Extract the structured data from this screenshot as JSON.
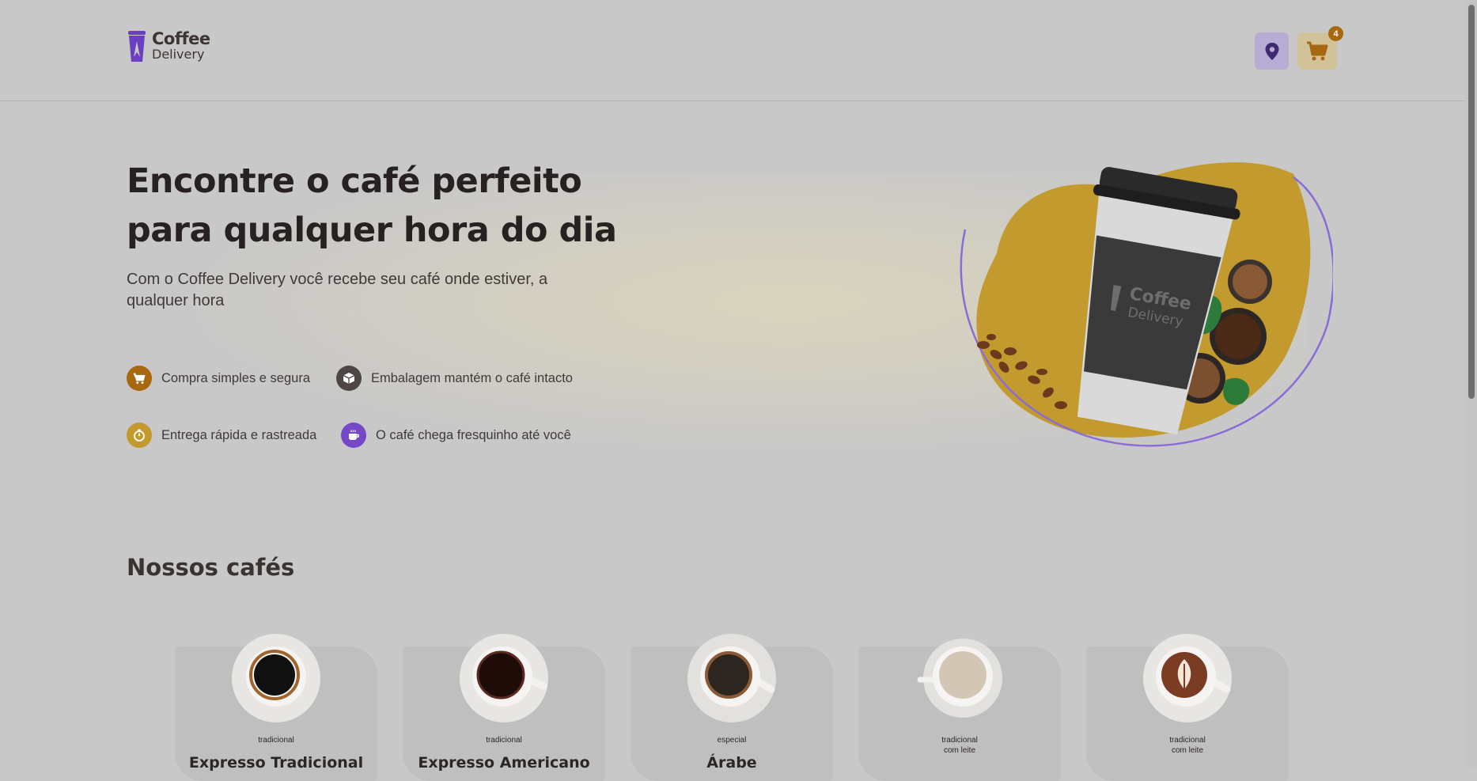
{
  "header": {
    "logo": {
      "line1": "Coffee",
      "line2": "Delivery",
      "icon": "coffee-cup-logo-icon"
    },
    "location_icon": "map-pin-icon",
    "cart": {
      "icon": "shopping-cart-icon",
      "count": "4"
    }
  },
  "hero": {
    "title": "Encontre o café perfeito para qualquer hora do dia",
    "subtitle": "Com o Coffee Delivery você recebe seu café onde estiver, a qualquer hora",
    "features": [
      {
        "text": "Compra simples e segura",
        "icon": "cart-icon",
        "color": "#a8680f"
      },
      {
        "text": "Embalagem mantém o café intacto",
        "icon": "package-icon",
        "color": "#4e4644"
      },
      {
        "text": "Entrega rápida e rastreada",
        "icon": "timer-icon",
        "color": "#c39a2d"
      },
      {
        "text": "O café chega fresquinho até você",
        "icon": "coffee-icon",
        "color": "#7548c8"
      }
    ],
    "illustration": {
      "cup_text_1": "Coffee",
      "cup_text_2": "Delivery"
    }
  },
  "section": {
    "title": "Nossos cafés"
  },
  "coffees": [
    {
      "name": "Expresso Tradicional",
      "tags": [
        "tradicional"
      ]
    },
    {
      "name": "Expresso Americano",
      "tags": [
        "tradicional"
      ]
    },
    {
      "name": "Árabe",
      "tags": [
        "especial"
      ]
    },
    {
      "name": "",
      "tags": [
        "tradicional",
        "com leite"
      ]
    },
    {
      "name": "",
      "tags": [
        "tradicional",
        "com leite"
      ]
    }
  ],
  "colors": {
    "yellow": "#c39a2d",
    "yellow_dark": "#a8680f",
    "purple": "#7548c8",
    "purple_dark": "#3e2a6e",
    "background": "#c8c8c8"
  }
}
